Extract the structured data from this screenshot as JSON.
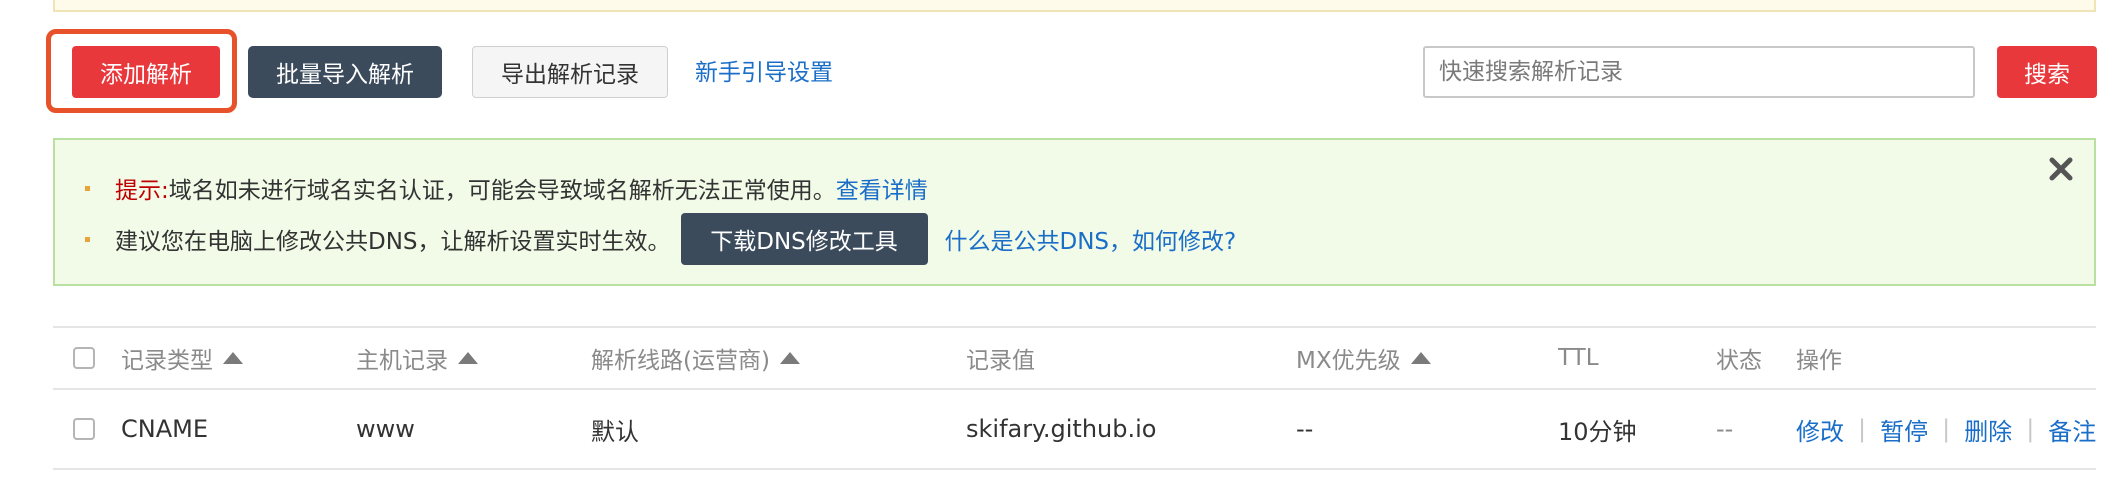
{
  "toolbar": {
    "add_label": "添加解析",
    "import_label": "批量导入解析",
    "export_label": "导出解析记录",
    "guide_link": "新手引导设置",
    "search_placeholder": "快速搜索解析记录",
    "search_label": "搜索"
  },
  "notice": {
    "tip_label": "提示:",
    "tip_text": " 域名如未进行域名实名认证，可能会导致域名解析无法正常使用。",
    "tip_link": "查看详情",
    "dns_text": "建议您在电脑上修改公共DNS，让解析设置实时生效。",
    "dns_button": "下载DNS修改工具",
    "dns_link": "什么是公共DNS，如何修改?"
  },
  "table": {
    "columns": {
      "type": "记录类型",
      "host": "主机记录",
      "line": "解析线路(运营商)",
      "value": "记录值",
      "mx": "MX优先级",
      "ttl": "TTL",
      "status": "状态",
      "actions": "操作"
    },
    "rows": [
      {
        "type": "CNAME",
        "host": "www",
        "line": "默认",
        "value": "skifary.github.io",
        "mx": "--",
        "ttl": "10分钟",
        "status": "--",
        "actions": {
          "edit": "修改",
          "pause": "暂停",
          "delete": "删除",
          "note": "备注"
        }
      }
    ]
  },
  "colors": {
    "primary_red": "#e8383b",
    "dark_slate": "#3b4b5c",
    "link_blue": "#1a6ec8",
    "notice_bg": "#f1fbe8",
    "highlight_border": "#e8522a"
  }
}
